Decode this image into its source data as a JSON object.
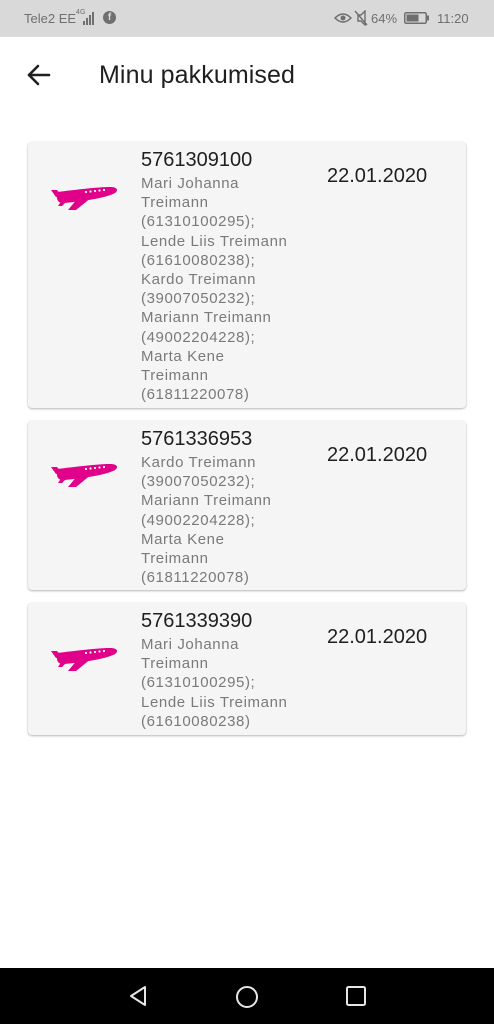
{
  "status_bar": {
    "carrier": "Tele2 EE",
    "network": "4G",
    "battery_percent": "64%",
    "time": "11:20"
  },
  "app_bar": {
    "title": "Minu pakkumised",
    "back_icon": "arrow-left-icon"
  },
  "colors": {
    "accent": "#e0008a",
    "card_background": "#f5f5f5",
    "status_bar": "#d9d9d9",
    "nav_bar": "#000000"
  },
  "offers": [
    {
      "number": "5761309100",
      "date": "22.01.2020",
      "icon": "airplane-icon",
      "name_lines": [
        "Mari Johanna",
        "Treimann",
        "(61310100295);",
        "Lende Liis Treimann",
        "(61610080238);",
        "Kardo Treimann",
        "(39007050232);",
        "Mariann Treimann",
        "(49002204228);",
        "Marta Kene",
        "Treimann",
        "(61811220078)"
      ]
    },
    {
      "number": "5761336953",
      "date": "22.01.2020",
      "icon": "airplane-icon",
      "name_lines": [
        "Kardo Treimann",
        "(39007050232);",
        "Mariann Treimann",
        "(49002204228);",
        "Marta Kene",
        "Treimann",
        "(61811220078)"
      ]
    },
    {
      "number": "5761339390",
      "date": "22.01.2020",
      "icon": "airplane-icon",
      "name_lines": [
        "Mari Johanna",
        "Treimann",
        "(61310100295);",
        "Lende Liis Treimann",
        "(61610080238)"
      ]
    }
  ],
  "nav_bar": {
    "back_icon": "triangle-back-icon",
    "home_icon": "circle-home-icon",
    "recents_icon": "square-recents-icon"
  }
}
